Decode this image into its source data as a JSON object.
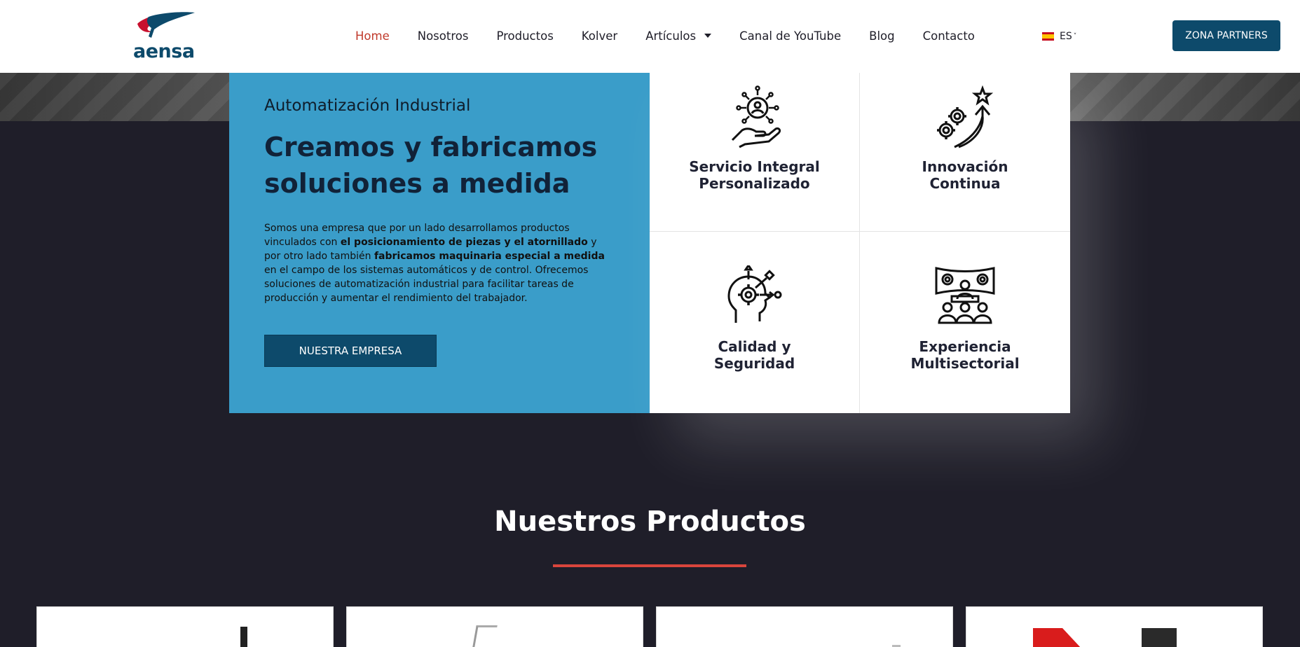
{
  "header": {
    "logo_text": "aensa",
    "nav": [
      {
        "label": "Home",
        "active": true
      },
      {
        "label": "Nosotros"
      },
      {
        "label": "Productos"
      },
      {
        "label": "Kolver"
      },
      {
        "label": "Artículos",
        "dropdown": true
      },
      {
        "label": "Canal de YouTube"
      },
      {
        "label": "Blog"
      },
      {
        "label": "Contacto"
      }
    ],
    "language": "ES",
    "partners_button": "ZONA PARTNERS"
  },
  "intro": {
    "subtitle": "Automatización Industrial",
    "title": "Creamos y fabricamos soluciones a medida",
    "text_1": "Somos una empresa que por un lado desarrollamos productos vinculados con ",
    "text_bold_1": "el posicionamiento de piezas y el atornillado",
    "text_2": " y por otro lado también ",
    "text_bold_2": "fabricamos maquinaria especial a medida",
    "text_3": " en el campo de los sistemas automáticos y de control. Ofrecemos soluciones de automatización industrial para facilitar tareas de producción y aumentar el rendimiento del trabajador.",
    "button": "NUESTRA EMPRESA"
  },
  "features": [
    {
      "label": "Servicio Integral\nPersonalizado",
      "icon": "hand-gear-person-icon"
    },
    {
      "label": "Innovación\nContinua",
      "icon": "gears-arrow-star-icon"
    },
    {
      "label": "Calidad y\nSeguridad",
      "icon": "head-gear-icon"
    },
    {
      "label": "Experiencia\nMultisectorial",
      "icon": "audience-screen-icon"
    }
  ],
  "products": {
    "title": "Nuestros Productos"
  },
  "colors": {
    "accent_red": "#c0392b",
    "brand_blue": "#0d4a6b",
    "intro_blue": "#3a9dc9",
    "dark_bg": "#1f1e29",
    "underline_red": "#d9453c"
  }
}
